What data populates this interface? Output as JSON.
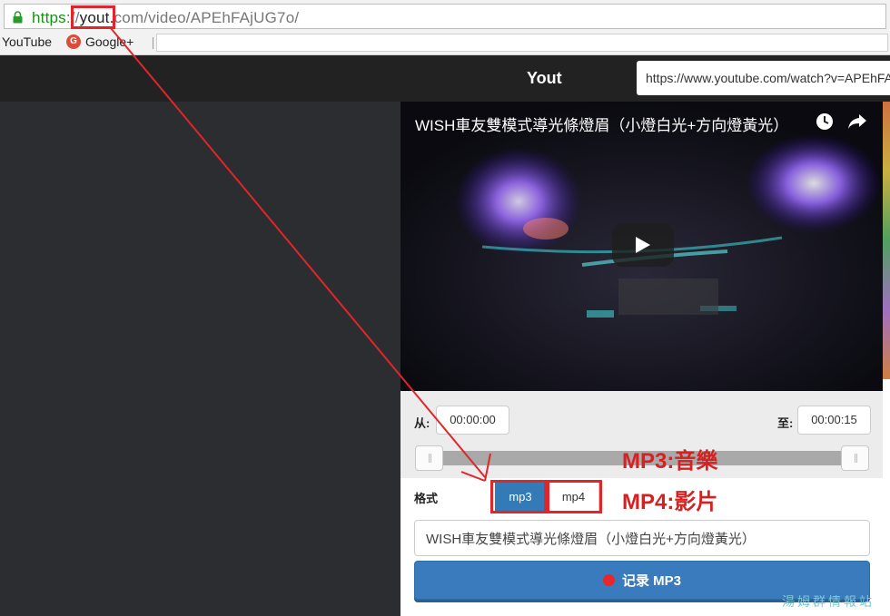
{
  "browser": {
    "url_protocol": "https:",
    "url_slashes": "//",
    "url_host": "yout.",
    "url_rest": "com/video/APEhFAjUG7o/",
    "bookmarks": [
      "YouTube",
      "Google+"
    ]
  },
  "site": {
    "brand": "Yout",
    "url_input_value": "https://www.youtube.com/watch?v=APEhFA"
  },
  "video": {
    "title": "WISH車友雙模式導光條燈眉（小燈白光+方向燈黃光）"
  },
  "trim": {
    "from_label": "从:",
    "from_value": "00:00:00",
    "to_label": "至:",
    "to_value": "00:00:15"
  },
  "format": {
    "label": "格式",
    "options": [
      "mp3",
      "mp4"
    ],
    "selected": "mp3"
  },
  "title_field_value": "WISH車友雙模式導光條燈眉（小燈白光+方向燈黃光）",
  "record_button_label": "记录 MP3",
  "annotations": {
    "mp3_note": "MP3:音樂",
    "mp4_note": "MP4:影片",
    "watermark": "湯姆群情報站"
  },
  "colors": {
    "accent": "#337ab7",
    "annotation_red": "#e0262a",
    "navbar": "#222222"
  }
}
